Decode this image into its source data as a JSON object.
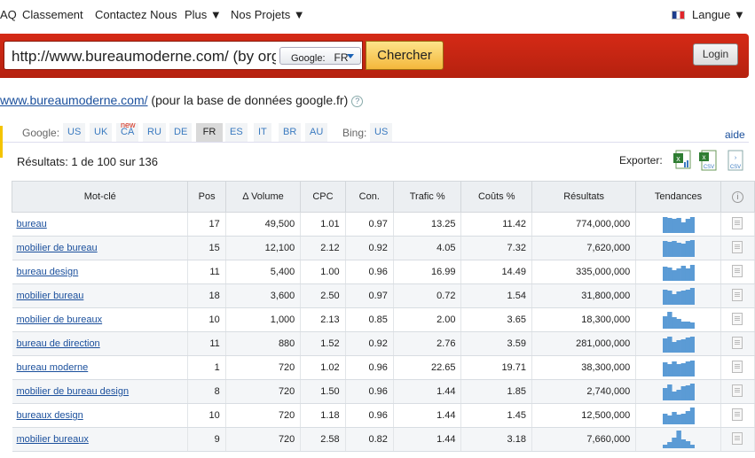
{
  "nav": {
    "items": [
      "AQ",
      "Classement",
      "Contactez Nous",
      "Plus ▼",
      "Nos Projets ▼"
    ],
    "language": "Langue ▼"
  },
  "search": {
    "url_value": "http://www.bureaumoderne.com/ (by organic)",
    "db_select_label": "Google:",
    "db_select_value": "FR",
    "button_label": "Chercher"
  },
  "login_label": "Login",
  "subtitle": {
    "link": "www.bureaumoderne.com/",
    "text": " (pour la base de données google.fr)"
  },
  "databases": {
    "google_label": "Google:",
    "google": [
      "US",
      "UK",
      "CA",
      "RU",
      "DE",
      "FR",
      "ES",
      "IT",
      "BR",
      "AU"
    ],
    "active": "FR",
    "new_tag": "new",
    "bing_label": "Bing:",
    "bing": [
      "US"
    ]
  },
  "aide": "aide",
  "results_text": "Résultats: 1 de 100 sur 136",
  "export_label": "Exporter:",
  "export_icons": [
    "excel-icon",
    "csv-excel-icon",
    "csv-icon"
  ],
  "columns": [
    "Mot-clé",
    "Pos",
    "Δ Volume",
    "CPC",
    "Con.",
    "Trafic %",
    "Coûts %",
    "Résultats",
    "Tendances",
    "ⓘ"
  ],
  "rows": [
    {
      "keyword": "bureau",
      "pos": "17",
      "volume": "49,500",
      "cpc": "1.01",
      "con": "0.97",
      "trafic": "13.25",
      "couts": "11.42",
      "resultats": "774,000,000",
      "trend": [
        0.9,
        0.85,
        0.8,
        0.85,
        0.6,
        0.8,
        0.9
      ]
    },
    {
      "keyword": "mobilier de bureau",
      "pos": "15",
      "volume": "12,100",
      "cpc": "2.12",
      "con": "0.92",
      "trafic": "4.05",
      "couts": "7.32",
      "resultats": "7,620,000",
      "trend": [
        0.9,
        0.85,
        0.9,
        0.8,
        0.75,
        0.9,
        0.95
      ]
    },
    {
      "keyword": "bureau design",
      "pos": "11",
      "volume": "5,400",
      "cpc": "1.00",
      "con": "0.96",
      "trafic": "16.99",
      "couts": "14.49",
      "resultats": "335,000,000",
      "trend": [
        0.8,
        0.75,
        0.6,
        0.7,
        0.85,
        0.7,
        0.9
      ]
    },
    {
      "keyword": "mobilier bureau",
      "pos": "18",
      "volume": "3,600",
      "cpc": "2.50",
      "con": "0.97",
      "trafic": "0.72",
      "couts": "1.54",
      "resultats": "31,800,000",
      "trend": [
        0.85,
        0.8,
        0.6,
        0.75,
        0.8,
        0.85,
        0.95
      ]
    },
    {
      "keyword": "mobilier de bureaux",
      "pos": "10",
      "volume": "1,000",
      "cpc": "2.13",
      "con": "0.85",
      "trafic": "2.00",
      "couts": "3.65",
      "resultats": "18,300,000",
      "trend": [
        0.7,
        0.95,
        0.65,
        0.55,
        0.4,
        0.4,
        0.35
      ]
    },
    {
      "keyword": "bureau de direction",
      "pos": "11",
      "volume": "880",
      "cpc": "1.52",
      "con": "0.92",
      "trafic": "2.76",
      "couts": "3.59",
      "resultats": "281,000,000",
      "trend": [
        0.8,
        0.9,
        0.6,
        0.7,
        0.75,
        0.85,
        0.9
      ]
    },
    {
      "keyword": "bureau moderne",
      "pos": "1",
      "volume": "720",
      "cpc": "1.02",
      "con": "0.96",
      "trafic": "22.65",
      "couts": "19.71",
      "resultats": "38,300,000",
      "trend": [
        0.8,
        0.7,
        0.85,
        0.7,
        0.75,
        0.85,
        0.9
      ]
    },
    {
      "keyword": "mobilier de bureau design",
      "pos": "8",
      "volume": "720",
      "cpc": "1.50",
      "con": "0.96",
      "trafic": "1.44",
      "couts": "1.85",
      "resultats": "2,740,000",
      "trend": [
        0.7,
        0.9,
        0.5,
        0.6,
        0.8,
        0.85,
        0.95
      ]
    },
    {
      "keyword": "bureaux design",
      "pos": "10",
      "volume": "720",
      "cpc": "1.18",
      "con": "0.96",
      "trafic": "1.44",
      "couts": "1.45",
      "resultats": "12,500,000",
      "trend": [
        0.6,
        0.5,
        0.7,
        0.55,
        0.6,
        0.75,
        0.95
      ]
    },
    {
      "keyword": "mobilier bureaux",
      "pos": "9",
      "volume": "720",
      "cpc": "2.58",
      "con": "0.82",
      "trafic": "1.44",
      "couts": "3.18",
      "resultats": "7,660,000",
      "trend": [
        0.2,
        0.35,
        0.6,
        1.0,
        0.5,
        0.4,
        0.2
      ]
    }
  ],
  "colors": {
    "red_bar": "#c9240f",
    "link": "#1a4f9c",
    "spark": "#5b9bd5"
  }
}
